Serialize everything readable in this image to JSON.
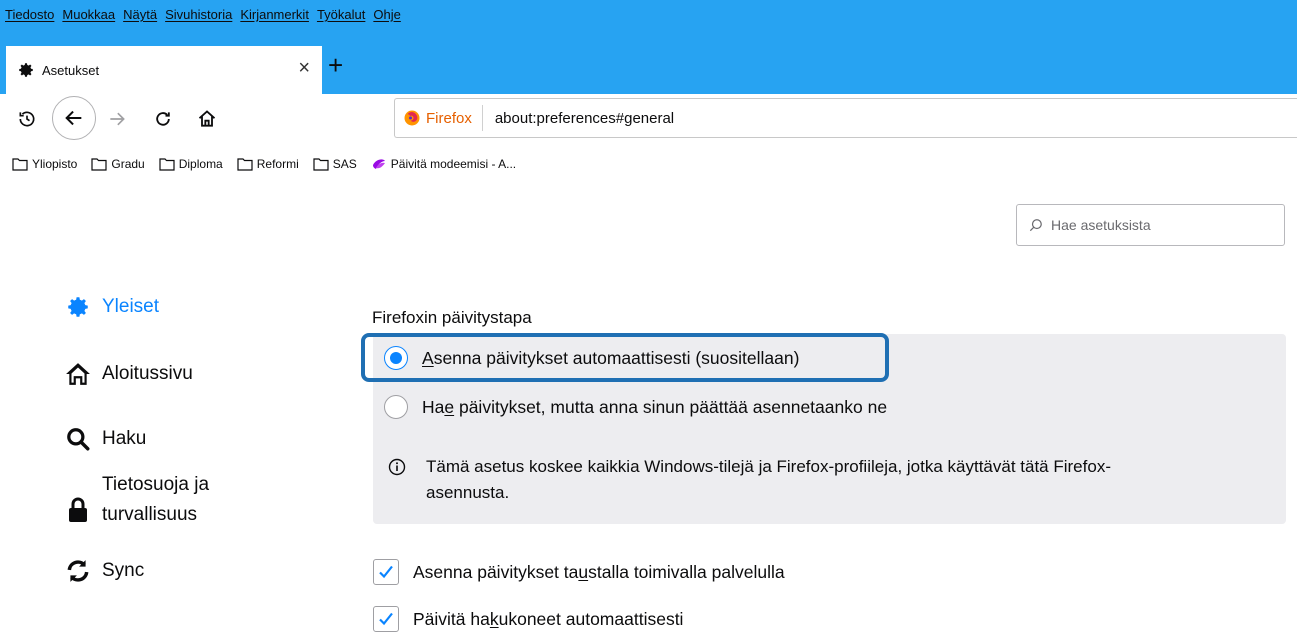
{
  "menubar": {
    "items": [
      {
        "label": "Tiedosto"
      },
      {
        "label": "Muokkaa"
      },
      {
        "label": "Näytä"
      },
      {
        "label": "Sivuhistoria"
      },
      {
        "label": "Kirjanmerkit"
      },
      {
        "label": "Työkalut"
      },
      {
        "label": "Ohje"
      }
    ]
  },
  "tab": {
    "title": "Asetukset",
    "icon": "gear-icon",
    "close_label": "×"
  },
  "newtab": {
    "label": "+"
  },
  "urlbar": {
    "identity": "Firefox",
    "url": "about:preferences#general"
  },
  "bookmarks": [
    {
      "label": "Yliopisto",
      "icon": "folder-icon"
    },
    {
      "label": "Gradu",
      "icon": "folder-icon"
    },
    {
      "label": "Diploma",
      "icon": "folder-icon"
    },
    {
      "label": "Reformi",
      "icon": "folder-icon"
    },
    {
      "label": "SAS",
      "icon": "folder-icon"
    },
    {
      "label": "Päivitä modeemisi - A...",
      "icon": "telia-logo-icon"
    }
  ],
  "search": {
    "placeholder": "Hae asetuksista"
  },
  "sidebar": {
    "items": [
      {
        "label": "Yleiset",
        "icon": "gear-icon",
        "active": true
      },
      {
        "label": "Aloitussivu",
        "icon": "home-icon"
      },
      {
        "label": "Haku",
        "icon": "search-icon"
      },
      {
        "label_line1": "Tietosuoja ja",
        "label_line2": "turvallisuus",
        "icon": "lock-icon"
      },
      {
        "label": "Sync",
        "icon": "sync-icon"
      }
    ]
  },
  "updates": {
    "title": "Firefoxin päivitystapa",
    "option_auto": {
      "pre": "",
      "accel": "A",
      "post": "senna päivitykset automaattisesti (suositellaan)",
      "checked": true
    },
    "option_check": {
      "pre": "Ha",
      "accel": "e",
      "post": " päivitykset, mutta anna sinun päättää asennetaanko ne",
      "checked": false
    },
    "info_line1": "Tämä asetus koskee kaikkia Windows-tilejä ja Firefox-profiileja, jotka käyttävät tätä Firefox-",
    "info_line2": "asennusta.",
    "service": {
      "pre": "Asenna päivitykset ta",
      "accel": "u",
      "post": "stalla toimivalla palvelulla",
      "checked": true
    },
    "engines": {
      "pre": "Päivitä ha",
      "accel": "k",
      "post": "ukoneet automaattisesti",
      "checked": true
    }
  },
  "colors": {
    "menubar_bg": "#27a3f2",
    "accent": "#0a84ff",
    "highlight": "#1f6fb3",
    "box_bg": "#ededf0"
  }
}
